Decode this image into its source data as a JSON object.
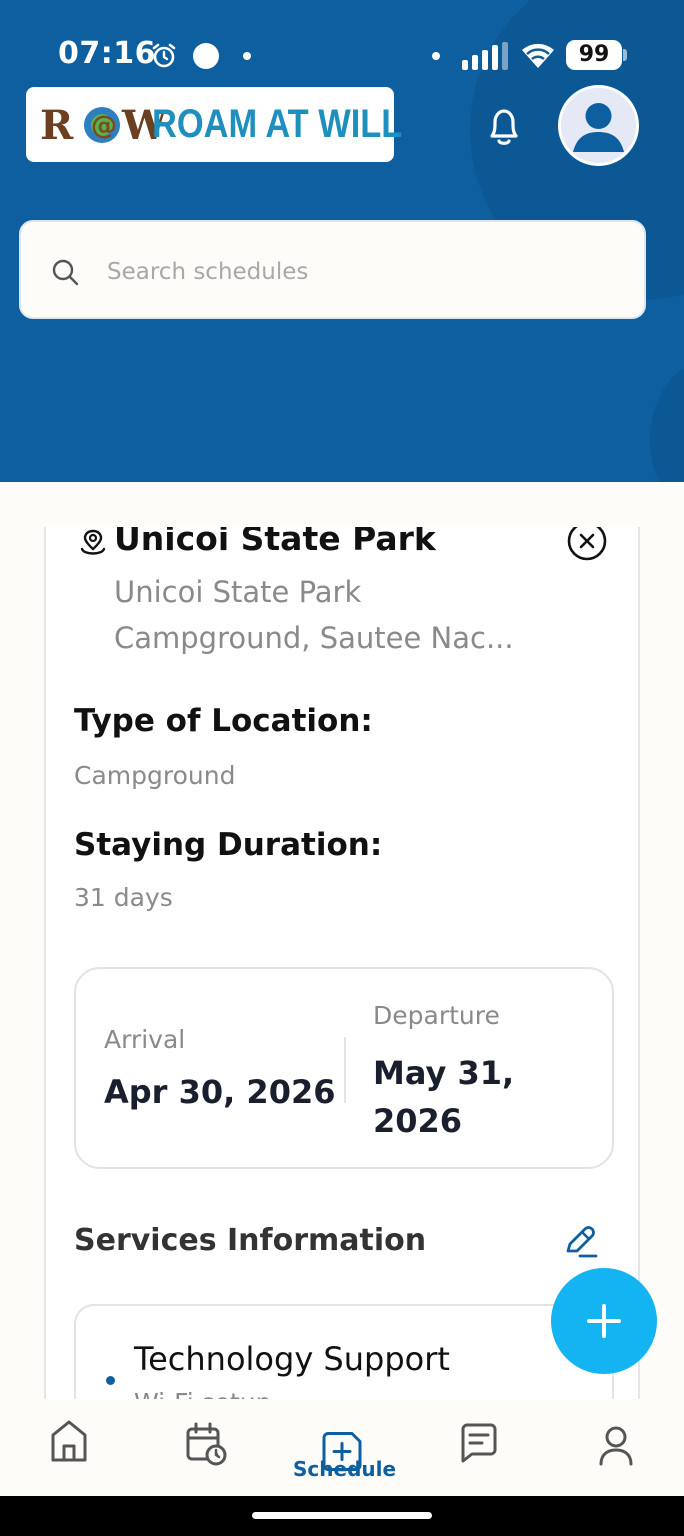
{
  "status_bar": {
    "time": "07:16",
    "battery": "99"
  },
  "brand": {
    "logo_mark": "R@W",
    "name": "ROAM AT WILL"
  },
  "icons": {
    "bell": "bell-icon",
    "profile": "user-avatar-icon",
    "search": "search-icon",
    "location": "location-pin-icon",
    "close": "close-circle-icon",
    "edit": "pencil-icon",
    "add": "plus-icon"
  },
  "search": {
    "placeholder": "Search schedules",
    "value": ""
  },
  "location": {
    "title": "Unicoi State Park",
    "address_line1": "Unicoi State Park",
    "address_line2": "Campground, Sautee Nac..."
  },
  "type_of_location": {
    "label": "Type of Location:",
    "value": "Campground"
  },
  "staying_duration": {
    "label": "Staying Duration:",
    "value": "31 days"
  },
  "dates": {
    "arrival_label": "Arrival",
    "arrival_value": "Apr 30, 2026",
    "departure_label": "Departure",
    "departure_value": "May 31, 2026"
  },
  "services": {
    "title": "Services Information",
    "items": [
      {
        "name": "Technology Support",
        "detail": "Wi-Fi setup"
      }
    ]
  },
  "bottom_nav": {
    "items": [
      {
        "id": "home",
        "label": ""
      },
      {
        "id": "calendar",
        "label": ""
      },
      {
        "id": "schedule",
        "label": "Schedule",
        "active": true
      },
      {
        "id": "messages",
        "label": ""
      },
      {
        "id": "profile",
        "label": ""
      }
    ]
  },
  "colors": {
    "header": "#0d5fa0",
    "accent": "#14b3f2",
    "brand_text": "#1f8fbf",
    "active_nav": "#0d5fa0"
  }
}
